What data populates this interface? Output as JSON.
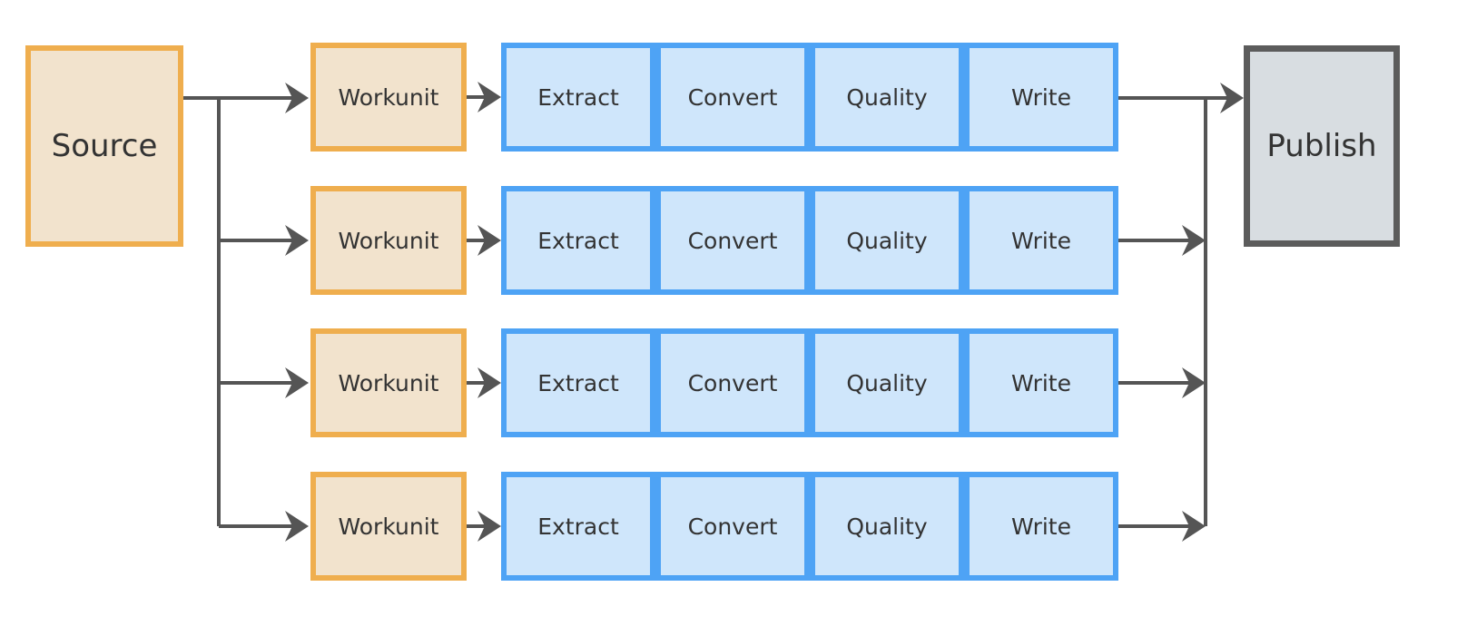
{
  "source": {
    "label": "Source"
  },
  "publish": {
    "label": "Publish"
  },
  "rows": [
    {
      "workunit": "Workunit",
      "stages": [
        "Extract",
        "Convert",
        "Quality",
        "Write"
      ]
    },
    {
      "workunit": "Workunit",
      "stages": [
        "Extract",
        "Convert",
        "Quality",
        "Write"
      ]
    },
    {
      "workunit": "Workunit",
      "stages": [
        "Extract",
        "Convert",
        "Quality",
        "Write"
      ]
    },
    {
      "workunit": "Workunit",
      "stages": [
        "Extract",
        "Convert",
        "Quality",
        "Write"
      ]
    }
  ],
  "colors": {
    "source_fill": "#f2e3cd",
    "source_border": "#efae4e",
    "stage_fill": "#cfe6fb",
    "stage_border": "#4ea3f5",
    "publish_fill": "#d8dde1",
    "publish_border": "#5c5c5c",
    "arrow": "#555555"
  }
}
